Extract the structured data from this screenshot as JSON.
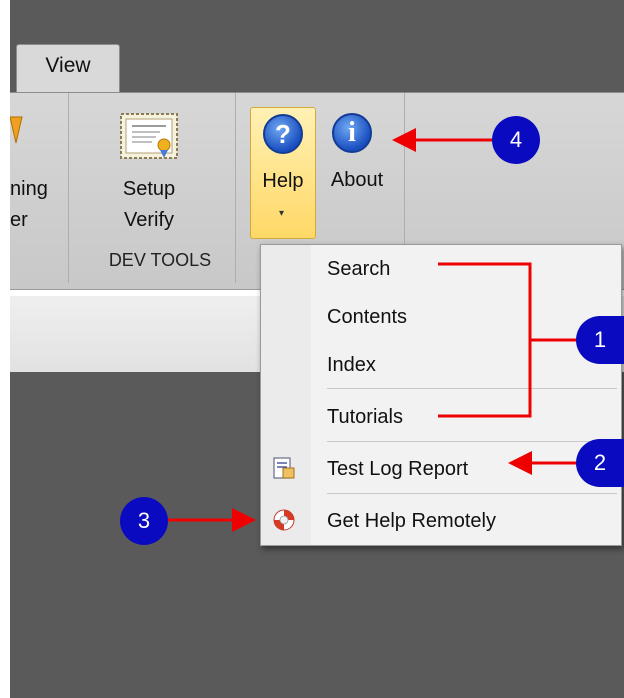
{
  "tabs": {
    "view_label": "View"
  },
  "ribbon": {
    "left_partial_line1": "ning",
    "left_partial_line2": "er",
    "setup_verify_line1": "Setup",
    "setup_verify_line2": "Verify",
    "group_dev_tools": "DEV TOOLS",
    "help_label": "Help",
    "help_caret": "▾",
    "help_icon_glyph": "?",
    "about_label": "About",
    "about_icon_glyph": "i"
  },
  "help_menu": {
    "items": [
      {
        "label": "Search"
      },
      {
        "label": "Contents"
      },
      {
        "label": "Index"
      },
      {
        "label": "Tutorials"
      },
      {
        "label": "Test Log Report",
        "icon": "report-icon"
      },
      {
        "label": "Get Help Remotely",
        "icon": "lifebuoy-icon"
      }
    ]
  },
  "annotations": {
    "badges": [
      "1",
      "2",
      "3",
      "4"
    ],
    "badge_color": "#0a0ac0",
    "arrow_color": "#ee0000"
  }
}
